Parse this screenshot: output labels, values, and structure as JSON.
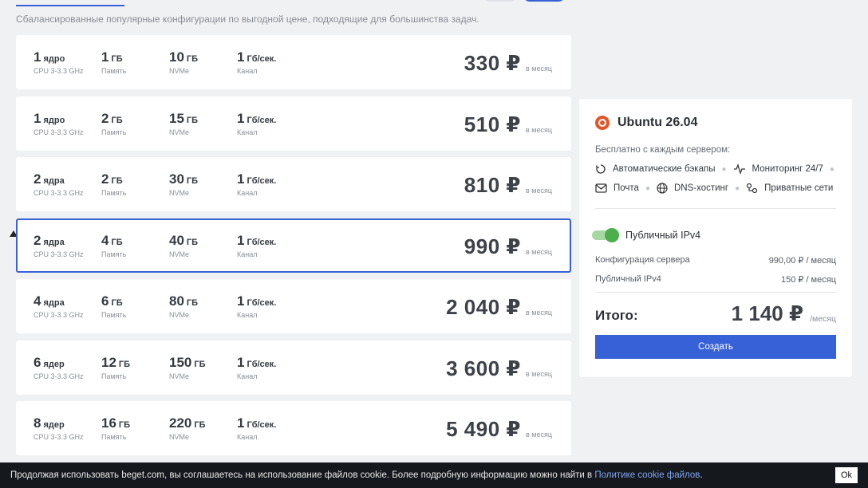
{
  "subtitle": "Сбалансированные популярные конфигурации по выгодной цене, подходящие для большинства задач.",
  "plans": [
    {
      "cores": "1",
      "cores_unit": "ядро",
      "cpu": "CPU 3-3.3 GHz",
      "ram": "1",
      "ram_unit": "ГБ",
      "ram_label": "Память",
      "disk": "10",
      "disk_unit": "ГБ",
      "disk_label": "NVMe",
      "net": "1",
      "net_unit": "Гб/сек.",
      "net_label": "Канал",
      "price": "330 ₽",
      "per": "в месяц",
      "selected": false
    },
    {
      "cores": "1",
      "cores_unit": "ядро",
      "cpu": "CPU 3-3.3 GHz",
      "ram": "2",
      "ram_unit": "ГБ",
      "ram_label": "Память",
      "disk": "15",
      "disk_unit": "ГБ",
      "disk_label": "NVMe",
      "net": "1",
      "net_unit": "Гб/сек.",
      "net_label": "Канал",
      "price": "510 ₽",
      "per": "в месяц",
      "selected": false
    },
    {
      "cores": "2",
      "cores_unit": "ядра",
      "cpu": "CPU 3-3.3 GHz",
      "ram": "2",
      "ram_unit": "ГБ",
      "ram_label": "Память",
      "disk": "30",
      "disk_unit": "ГБ",
      "disk_label": "NVMe",
      "net": "1",
      "net_unit": "Гб/сек.",
      "net_label": "Канал",
      "price": "810 ₽",
      "per": "в месяц",
      "selected": false
    },
    {
      "cores": "2",
      "cores_unit": "ядра",
      "cpu": "CPU 3-3.3 GHz",
      "ram": "4",
      "ram_unit": "ГБ",
      "ram_label": "Память",
      "disk": "40",
      "disk_unit": "ГБ",
      "disk_label": "NVMe",
      "net": "1",
      "net_unit": "Гб/сек.",
      "net_label": "Канал",
      "price": "990 ₽",
      "per": "в месяц",
      "selected": true
    },
    {
      "cores": "4",
      "cores_unit": "ядра",
      "cpu": "CPU 3-3.3 GHz",
      "ram": "6",
      "ram_unit": "ГБ",
      "ram_label": "Память",
      "disk": "80",
      "disk_unit": "ГБ",
      "disk_label": "NVMe",
      "net": "1",
      "net_unit": "Гб/сек.",
      "net_label": "Канал",
      "price": "2 040 ₽",
      "per": "в месяц",
      "selected": false
    },
    {
      "cores": "6",
      "cores_unit": "ядер",
      "cpu": "CPU 3-3.3 GHz",
      "ram": "12",
      "ram_unit": "ГБ",
      "ram_label": "Память",
      "disk": "150",
      "disk_unit": "ГБ",
      "disk_label": "NVMe",
      "net": "1",
      "net_unit": "Гб/сек.",
      "net_label": "Канал",
      "price": "3 600 ₽",
      "per": "в месяц",
      "selected": false
    },
    {
      "cores": "8",
      "cores_unit": "ядер",
      "cpu": "CPU 3-3.3 GHz",
      "ram": "16",
      "ram_unit": "ГБ",
      "ram_label": "Память",
      "disk": "220",
      "disk_unit": "ГБ",
      "disk_label": "NVMe",
      "net": "1",
      "net_unit": "Гб/сек.",
      "net_label": "Канал",
      "price": "5 490 ₽",
      "per": "в месяц",
      "selected": false
    }
  ],
  "summary": {
    "os_title": "Ubuntu 26.04",
    "free_label": "Бесплатно с каждым сервером:",
    "features": [
      {
        "label": "Автоматические бэкапы",
        "icon": "backup-icon"
      },
      {
        "label": "Мониторинг 24/7",
        "icon": "monitoring-icon"
      },
      {
        "label": "Почта",
        "icon": "mail-icon"
      },
      {
        "label": "DNS-хостинг",
        "icon": "globe-icon"
      },
      {
        "label": "Приватные сети",
        "icon": "network-icon"
      }
    ],
    "ipv4_toggle_label": "Публичный IPv4",
    "ipv4_enabled": true,
    "config_label": "Конфигурация сервера",
    "config_price": "990,00 ₽ / месяц",
    "ipv4_label": "Публичный IPv4",
    "ipv4_price": "150 ₽ / месяц",
    "total_label": "Итого:",
    "total_amount": "1 140 ₽",
    "total_per": "/месяц",
    "create_label": "Создать"
  },
  "cookie": {
    "text": "Продолжая использовать beget.com, вы соглашаетесь на использование файлов cookie. Более подробную информацию можно найти в ",
    "link": "Политике cookie файлов",
    "end": ".",
    "ok": "Ok"
  },
  "colors": {
    "accent": "#3761d6",
    "toggle": "#4cae4c",
    "os": "#e2552b",
    "cookie_bg": "#15181c"
  }
}
